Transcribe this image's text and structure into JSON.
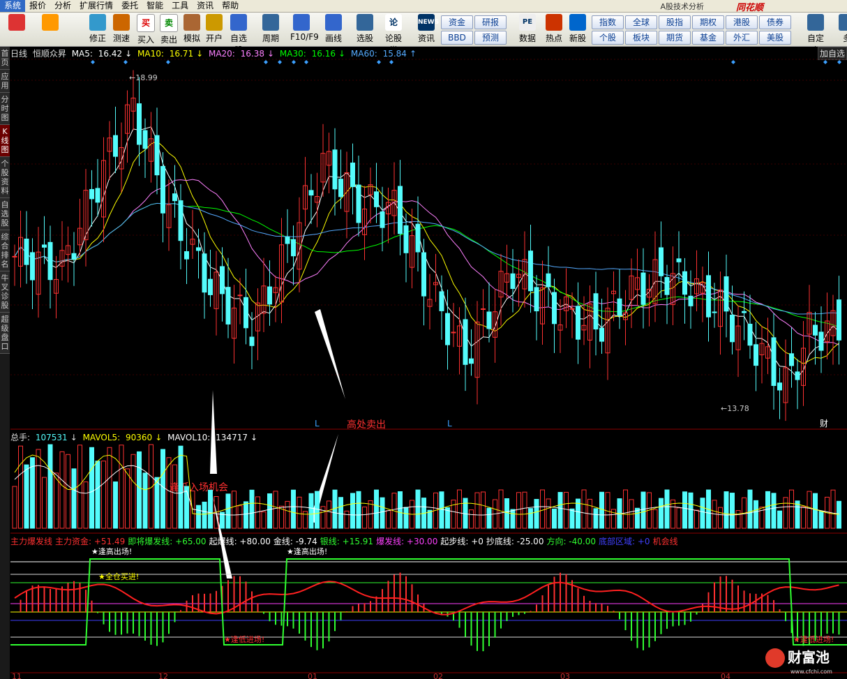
{
  "menu": {
    "items": [
      "系统",
      "报价",
      "分析",
      "扩展行情",
      "委托",
      "智能",
      "工具",
      "资讯",
      "帮助"
    ],
    "brand": "同花顺",
    "window_title": "A股技术分析"
  },
  "toolbar": {
    "buttons": [
      "",
      "",
      "修正",
      "测速",
      "买入",
      "卖出",
      "模拟",
      "开户",
      "自选股",
      "周期",
      "F10/F9",
      "画线",
      "选股",
      "论股堂",
      "资讯",
      "数据",
      "热点",
      "新股",
      "自定义",
      "多"
    ],
    "icon_glyphs": {
      "buy": "买",
      "sell": "卖",
      "news": "NEWS",
      "pe": "PE",
      "lun": "论"
    },
    "mid_grid": [
      "资金",
      "研报",
      "BBD",
      "预测"
    ],
    "right_grid": [
      "指数",
      "全球",
      "股指",
      "期权",
      "港股",
      "债券",
      "个股",
      "板块",
      "期货",
      "基金",
      "外汇",
      "美股"
    ]
  },
  "sidebar": {
    "tabs": [
      "首页",
      "应用",
      "分时图",
      "K线图",
      "个股资料",
      "自选股",
      "综合排名",
      "牛叉诊股",
      "超级盘口"
    ]
  },
  "kline": {
    "period": "日线",
    "stock": "恒顺众昇",
    "ma5_label": "MA5:",
    "ma5": "16.42",
    "ma10_label": "MA10:",
    "ma10": "16.71",
    "ma20_label": "MA20:",
    "ma20": "16.38",
    "ma30_label": "MA30:",
    "ma30": "16.16",
    "ma60_label": "MA60:",
    "ma60": "15.84",
    "high_label": "18.99",
    "low_label": "13.78",
    "add_watch": "加自选",
    "marker_L": "L",
    "marker_cai": "财",
    "annotation_sell": "高处卖出"
  },
  "volume": {
    "total_label": "总手:",
    "total": "107531",
    "mavol5_label": "MAVOL5:",
    "mavol5": "90360",
    "mavol10_label": "MAVOL10:",
    "mavol10": "134717",
    "annotation_buy": "逢低入场机会"
  },
  "indicator": {
    "items": [
      {
        "text": "主力爆发线",
        "color": "#ff3030"
      },
      {
        "text": "主力资金: +51.49",
        "color": "#ff3030"
      },
      {
        "text": "即将爆发线: +65.00",
        "color": "#30ff30"
      },
      {
        "text": "起爆线: +80.00",
        "color": "#ffffff"
      },
      {
        "text": "金线: -9.74",
        "color": "#ffffff"
      },
      {
        "text": "银线: +15.91",
        "color": "#30ff30"
      },
      {
        "text": "爆发线: +30.00",
        "color": "#ff40ff"
      },
      {
        "text": "起步线: +0",
        "color": "#ffffff"
      },
      {
        "text": "抄底线: -25.00",
        "color": "#ffffff"
      },
      {
        "text": "方向: -40.00",
        "color": "#30ff30"
      },
      {
        "text": "底部区域: +0",
        "color": "#4040ff"
      },
      {
        "text": "机会线",
        "color": "#ff3030"
      }
    ],
    "label_exit_high": "★逢高出场!",
    "label_buy_zone": "★全仓买进!",
    "label_enter_low": "★逢低进场!",
    "label_enter_low2": "★逢低进场!"
  },
  "x_axis": [
    "11",
    "12",
    "01",
    "02",
    "03",
    "04"
  ],
  "watermark": {
    "text": "财富池",
    "url": "www.cfchi.com"
  },
  "colors": {
    "up": "#ff3232",
    "down": "#54fcfc",
    "ma5": "#ffffff",
    "ma10": "#ffff00",
    "ma20": "#ff80ff",
    "ma30": "#00ff00",
    "ma60": "#55aaff",
    "annotation": "#ff3030"
  }
}
